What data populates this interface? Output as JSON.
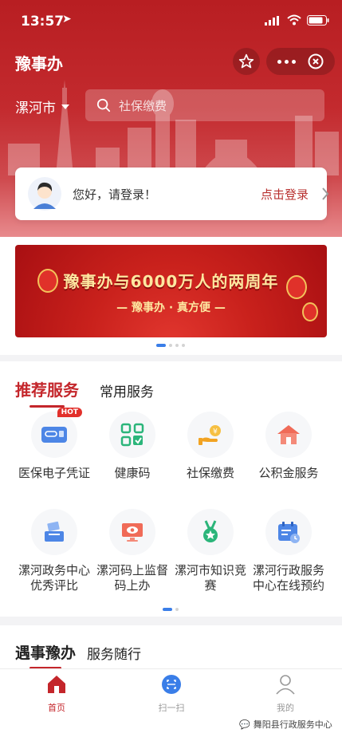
{
  "status_bar": {
    "time": "13:57"
  },
  "app": {
    "title": "豫事办"
  },
  "location": {
    "city": "漯河市"
  },
  "search": {
    "placeholder": "社保缴费"
  },
  "login_card": {
    "greeting": "您好，请登录！",
    "action": "点击登录"
  },
  "banner": {
    "headline": "豫事办与6000万人的两周年",
    "subtitle": "— 豫事办 · 真方便 —"
  },
  "services": {
    "tabs": [
      {
        "label": "推荐服务",
        "active": true
      },
      {
        "label": "常用服务",
        "active": false
      }
    ],
    "items": [
      {
        "label": "医保电子凭证",
        "icon": "medical-insurance-card-icon",
        "badge": "HOT"
      },
      {
        "label": "健康码",
        "icon": "health-code-icon"
      },
      {
        "label": "社保缴费",
        "icon": "social-security-payment-icon"
      },
      {
        "label": "公积金服务",
        "icon": "housing-fund-icon"
      },
      {
        "label": "漯河政务中心优秀评比",
        "icon": "vote-box-icon"
      },
      {
        "label": "漯河码上监督码上办",
        "icon": "monitor-eye-icon"
      },
      {
        "label": "漯河市知识竞赛",
        "icon": "medal-icon"
      },
      {
        "label": "漯河行政服务中心在线预约",
        "icon": "calendar-icon"
      }
    ]
  },
  "events": {
    "tabs": [
      {
        "label": "遇事豫办",
        "active": true
      },
      {
        "label": "服务随行",
        "active": false
      }
    ]
  },
  "tabbar": {
    "items": [
      {
        "label": "首页"
      },
      {
        "label": "扫一扫"
      },
      {
        "label": "我的"
      }
    ]
  },
  "watermark": {
    "text": "舞阳县行政服务中心"
  },
  "colors": {
    "brand_red": "#c4262b",
    "accent_blue": "#3a7ee8"
  }
}
